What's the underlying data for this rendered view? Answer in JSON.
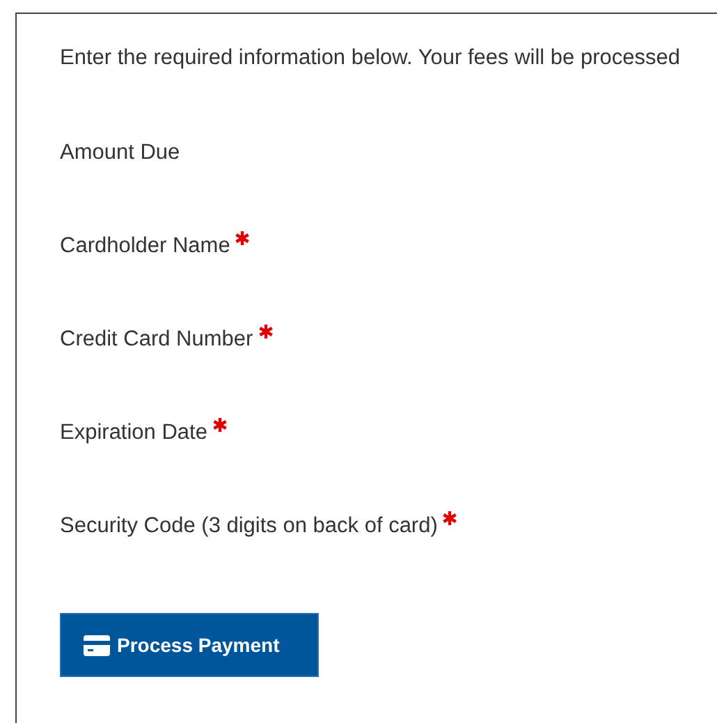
{
  "intro": "Enter the required information below. Your fees will be processed",
  "fields": [
    {
      "label": "Amount Due",
      "required": false
    },
    {
      "label": "Cardholder Name",
      "required": true
    },
    {
      "label": "Credit Card Number",
      "required": true
    },
    {
      "label": "Expiration Date",
      "required": true
    },
    {
      "label": "Security Code (3 digits on back of card)",
      "required": true
    }
  ],
  "submit": {
    "label": "Process Payment"
  }
}
